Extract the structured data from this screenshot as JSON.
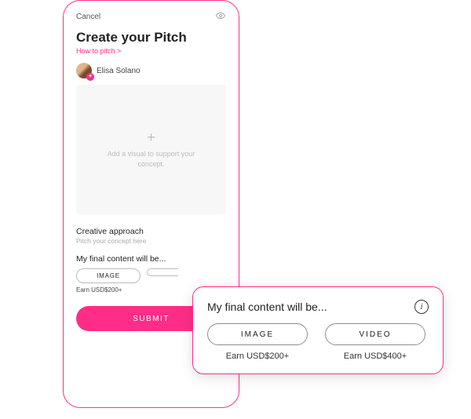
{
  "phone": {
    "cancel": "Cancel",
    "title": "Create your Pitch",
    "howto": "How to pitch >",
    "user_name": "Elisa Solano",
    "dropzone_hint": "Add a visual to support your concept.",
    "approach_label": "Creative approach",
    "approach_hint": "Pitch your concept here",
    "final_label": "My final content will be...",
    "chip_image": "IMAGE",
    "earn_image": "Earn USD$200+",
    "submit": "SUBMIT"
  },
  "overlay": {
    "title": "My final content will be...",
    "options": {
      "image": {
        "label": "IMAGE",
        "earn": "Earn USD$200+"
      },
      "video": {
        "label": "VIDEO",
        "earn": "Earn USD$400+"
      }
    }
  },
  "colors": {
    "accent": "#ff2d87"
  }
}
